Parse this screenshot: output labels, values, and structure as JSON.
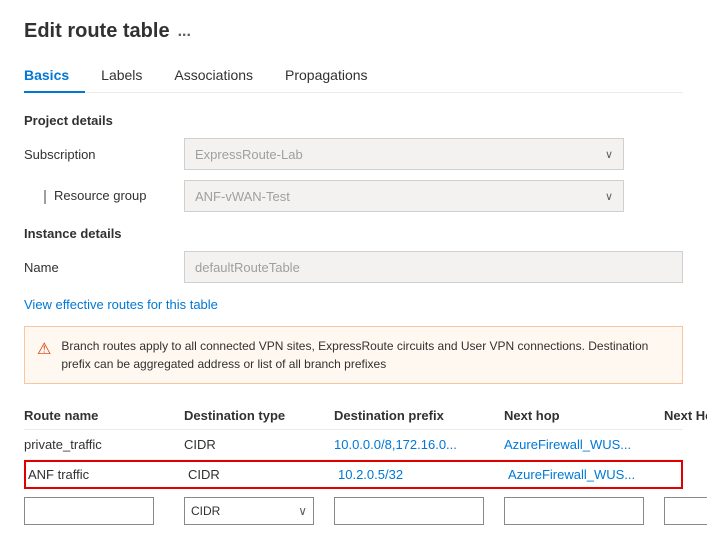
{
  "page": {
    "title": "Edit route table",
    "ellipsis": "..."
  },
  "tabs": [
    {
      "id": "basics",
      "label": "Basics",
      "active": true
    },
    {
      "id": "labels",
      "label": "Labels",
      "active": false
    },
    {
      "id": "associations",
      "label": "Associations",
      "active": false
    },
    {
      "id": "propagations",
      "label": "Propagations",
      "active": false
    }
  ],
  "project_details": {
    "title": "Project details",
    "subscription_label": "Subscription",
    "subscription_value": "ExpressRoute-Lab",
    "resource_group_label": "Resource group",
    "resource_group_value": "ANF-vWAN-Test"
  },
  "instance_details": {
    "title": "Instance details",
    "name_label": "Name",
    "name_value": "defaultRouteTable"
  },
  "effective_routes_link": "View effective routes for this table",
  "warning": {
    "icon": "⚠",
    "text": "Branch routes apply to all connected VPN sites, ExpressRoute circuits and User VPN connections. Destination prefix can be aggregated address or list of all branch prefixes"
  },
  "table": {
    "headers": [
      "Route name",
      "Destination type",
      "Destination prefix",
      "Next hop",
      "Next Hop IP"
    ],
    "rows": [
      {
        "route_name": "private_traffic",
        "destination_type": "CIDR",
        "destination_prefix": "10.0.0.0/8,172.16.0...",
        "next_hop": "AzureFirewall_WUS...",
        "next_hop_ip": "",
        "highlighted": false
      },
      {
        "route_name": "ANF traffic",
        "destination_type": "CIDR",
        "destination_prefix": "10.2.0.5/32",
        "next_hop": "AzureFirewall_WUS...",
        "next_hop_ip": "",
        "highlighted": true
      }
    ],
    "new_row": {
      "type_placeholder": "CIDR",
      "prefix_placeholder": "",
      "hop_placeholder": "",
      "chevron": "∨"
    }
  }
}
